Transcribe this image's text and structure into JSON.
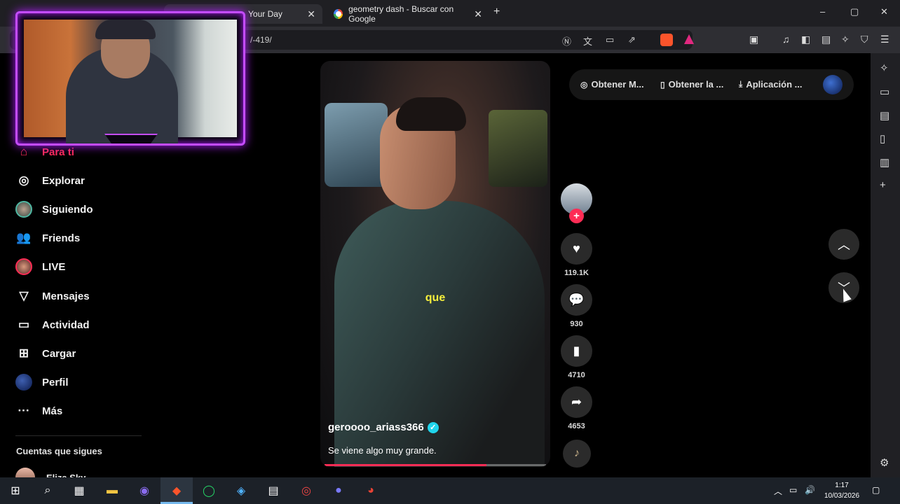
{
  "browser": {
    "tabs": [
      {
        "title": "Your Day"
      },
      {
        "title": "geometry dash - Buscar con Google"
      }
    ],
    "new_tab": "+",
    "url": "/-419/",
    "window": {
      "minimize": "–",
      "maximize": "▢",
      "close": "✕"
    }
  },
  "nav": {
    "items": [
      {
        "label": "Para ti",
        "icon": "home-icon"
      },
      {
        "label": "Explorar",
        "icon": "compass-icon"
      },
      {
        "label": "Siguiendo",
        "icon": "following-avatar"
      },
      {
        "label": "Friends",
        "icon": "friends-icon"
      },
      {
        "label": "LIVE",
        "icon": "live-avatar"
      },
      {
        "label": "Mensajes",
        "icon": "messages-icon"
      },
      {
        "label": "Actividad",
        "icon": "activity-icon"
      },
      {
        "label": "Cargar",
        "icon": "upload-icon"
      },
      {
        "label": "Perfil",
        "icon": "profile-avatar"
      },
      {
        "label": "Más",
        "icon": "more-icon"
      }
    ],
    "following_header": "Cuentas que sigues",
    "following": [
      {
        "name": "Eliza Sky"
      }
    ]
  },
  "video": {
    "caption_text": "que",
    "author": "geroooo_ariass366",
    "description": "Se viene algo muy grande.",
    "progress": 0.73
  },
  "actions": {
    "likes": "119.1K",
    "comments": "930",
    "saves": "4710",
    "shares": "4653"
  },
  "top_pills": {
    "coins": "Obtener M...",
    "app": "Obtener la ...",
    "download": "Aplicación ..."
  },
  "taskbar": {
    "time": "1:17",
    "date": "10/03/2026"
  },
  "colors": {
    "tiktok_red": "#fe2c55",
    "caption_yellow": "#f6ef3c",
    "webcam_frame": "#c44cff",
    "verified": "#20d5ec"
  }
}
